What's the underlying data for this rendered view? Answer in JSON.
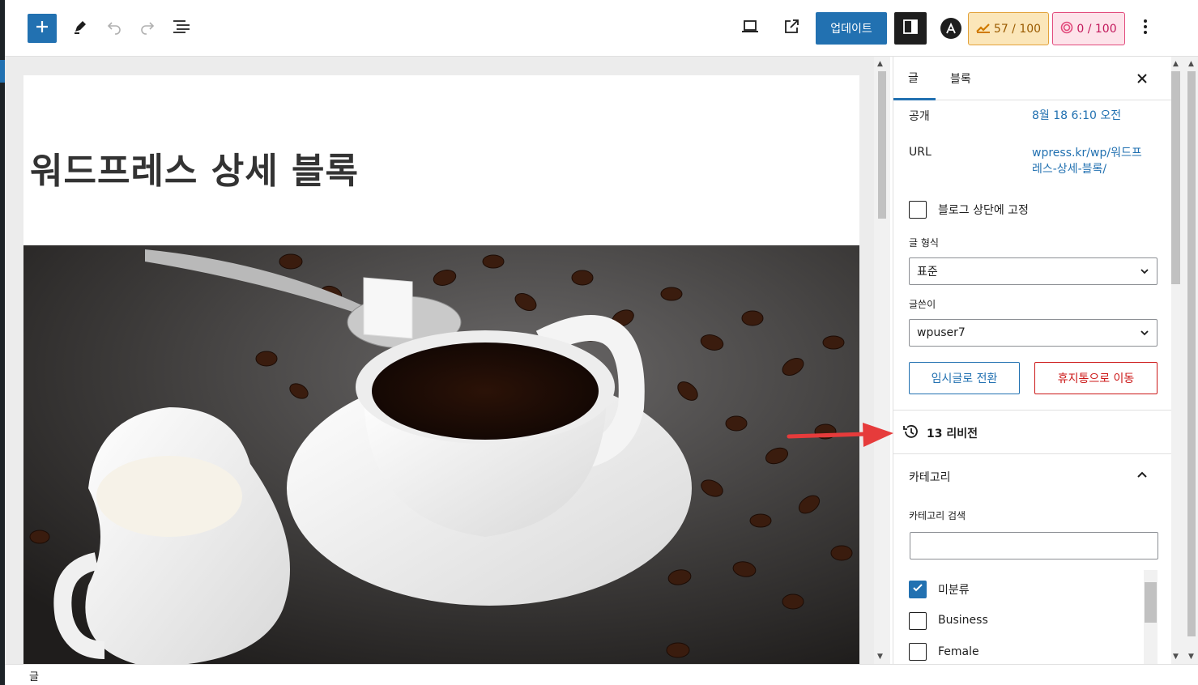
{
  "toolbar": {
    "add_icon": "plus-icon",
    "tools_icon": "pencil-icon",
    "undo_icon": "undo-icon",
    "redo_icon": "redo-icon",
    "list_view_icon": "list-view-icon",
    "preview_icon": "laptop-icon",
    "view_post_icon": "external-link-icon",
    "update_label": "업데이트",
    "seo_score": "57 / 100",
    "readability_score": "0 / 100",
    "more_icon": "more-vertical-icon"
  },
  "editor": {
    "title": "워드프레스 상세 블록",
    "image_icon": "coffee-photo"
  },
  "sidebar": {
    "tabs": [
      {
        "label": "글",
        "active": true
      },
      {
        "label": "블록",
        "active": false
      }
    ],
    "close_icon": "close-icon",
    "visibility": {
      "label": "공개",
      "value": "8월 18 6:10 오전"
    },
    "url": {
      "label": "URL",
      "value_line1": "wpress.kr/wp/워드프",
      "value_line2": "레스-상세-블록/"
    },
    "sticky": {
      "label": "블로그 상단에 고정",
      "checked": false
    },
    "post_format": {
      "label": "글 형식",
      "value": "표준"
    },
    "author": {
      "label": "글쓴이",
      "value": "wpuser7"
    },
    "switch_draft_label": "임시글로 전환",
    "trash_label": "휴지통으로 이동",
    "revisions_label": "13 리비전",
    "categories": {
      "title": "카테고리",
      "search_label": "카테고리 검색",
      "search_value": "",
      "items": [
        {
          "label": "미분류",
          "checked": true
        },
        {
          "label": "Business",
          "checked": false
        },
        {
          "label": "Female",
          "checked": false
        }
      ]
    }
  },
  "footer": {
    "breadcrumb": "글"
  },
  "colors": {
    "accent": "#2271b1",
    "danger": "#cc1818",
    "annotation_arrow": "#e63b3b",
    "seo_badge_bg": "#fbe6b9",
    "readability_badge_bg": "#fde3ea"
  }
}
